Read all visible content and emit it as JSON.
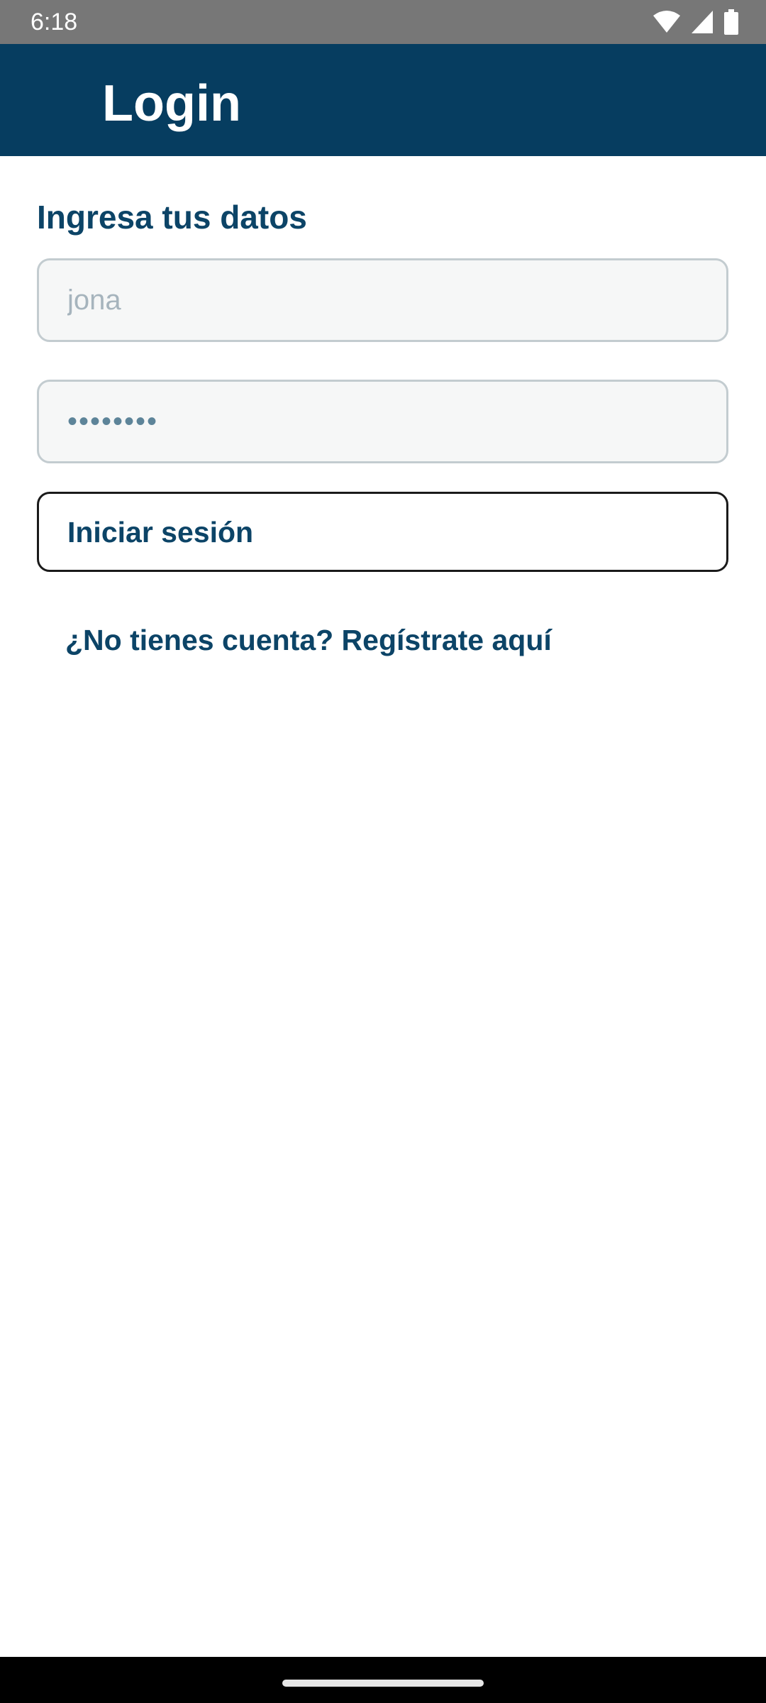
{
  "status_bar": {
    "time": "6:18",
    "icons": [
      "wifi-icon",
      "signal-icon",
      "battery-icon"
    ],
    "background": "#777777"
  },
  "app_bar": {
    "title": "Login",
    "background": "#063d60"
  },
  "form": {
    "heading": "Ingresa tus datos",
    "username": {
      "value": "",
      "placeholder": "jona"
    },
    "password": {
      "value": "••••••••",
      "placeholder": ""
    },
    "submit_label": "Iniciar sesión",
    "register_link": "¿No tienes cuenta? Regístrate aquí"
  },
  "colors": {
    "primary": "#063d60",
    "text_accent": "#0c4467",
    "field_bg": "#f6f7f7",
    "field_border": "#c3ccd0"
  }
}
